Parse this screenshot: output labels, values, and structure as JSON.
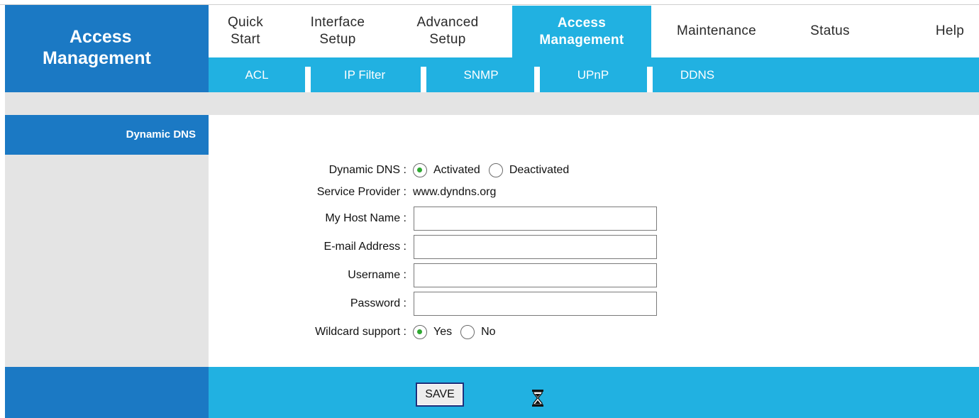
{
  "header": {
    "title_line1": "Access",
    "title_line2": "Management"
  },
  "mainnav": {
    "items": [
      {
        "line1": "Quick",
        "line2": "Start"
      },
      {
        "line1": "Interface",
        "line2": "Setup"
      },
      {
        "line1": "Advanced",
        "line2": "Setup"
      },
      {
        "line1": "Access",
        "line2": "Management"
      },
      {
        "line1": "Maintenance",
        "line2": ""
      },
      {
        "line1": "Status",
        "line2": ""
      },
      {
        "line1": "Help",
        "line2": ""
      }
    ],
    "active_index": 3
  },
  "subnav": {
    "items": [
      "ACL",
      "IP Filter",
      "SNMP",
      "UPnP",
      "DDNS"
    ]
  },
  "section": {
    "label": "Dynamic DNS"
  },
  "form": {
    "dynamic_dns": {
      "label": "Dynamic DNS :",
      "option_on": "Activated",
      "option_off": "Deactivated",
      "selected": "Activated"
    },
    "service_provider": {
      "label": "Service Provider :",
      "value": "www.dyndns.org"
    },
    "host_name": {
      "label": "My Host Name :",
      "value": ""
    },
    "email": {
      "label": "E-mail Address :",
      "value": ""
    },
    "username": {
      "label": "Username :",
      "value": ""
    },
    "password": {
      "label": "Password :",
      "value": ""
    },
    "wildcard": {
      "label": "Wildcard support :",
      "option_on": "Yes",
      "option_off": "No",
      "selected": "Yes"
    }
  },
  "footer": {
    "save_label": "SAVE"
  },
  "colors": {
    "dark_blue": "#1b79c4",
    "light_blue": "#21b1e1",
    "grey": "#e4e4e4",
    "radio_selected": "#2fa832"
  },
  "icons": {
    "hourglass": "hourglass-icon"
  }
}
